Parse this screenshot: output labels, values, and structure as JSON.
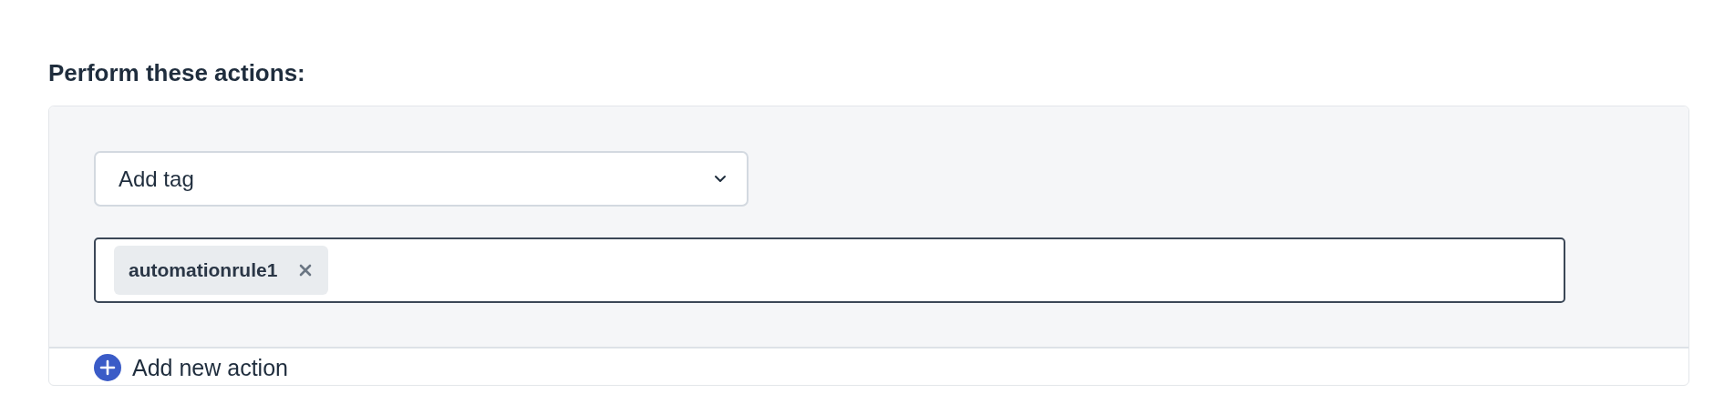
{
  "heading": "Perform these actions:",
  "action_select": {
    "value": "Add tag"
  },
  "tags": [
    {
      "label": "automationrule1"
    }
  ],
  "add_action": {
    "label": "Add new action"
  }
}
